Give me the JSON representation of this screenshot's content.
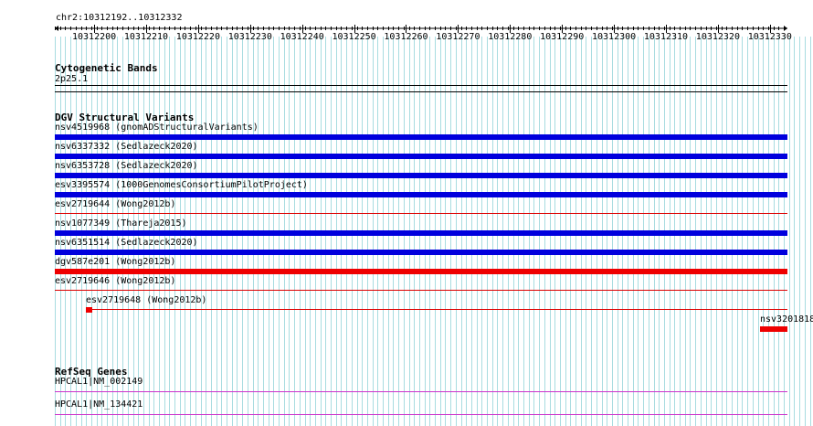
{
  "ruler": {
    "location": "chr2:10312192..10312332",
    "ticks": [
      "10312200",
      "10312210",
      "10312220",
      "10312230",
      "10312240",
      "10312250",
      "10312260",
      "10312270",
      "10312280",
      "10312290",
      "10312300",
      "10312310",
      "10312320",
      "10312330"
    ]
  },
  "cytobands": {
    "title": "Cytogenetic Bands",
    "band": "2p25.1"
  },
  "dgv": {
    "title": "DGV Structural Variants",
    "features": [
      {
        "label": "nsv4519968 (gnomADStructuralVariants)",
        "color": "#0000dd",
        "style": "thick"
      },
      {
        "label": "nsv6337332 (Sedlazeck2020)",
        "color": "#0000dd",
        "style": "thick"
      },
      {
        "label": "nsv6353728 (Sedlazeck2020)",
        "color": "#0000dd",
        "style": "thick"
      },
      {
        "label": "esv3395574 (1000GenomesConsortiumPilotProject)",
        "color": "#0000dd",
        "style": "thick"
      },
      {
        "label": "esv2719644 (Wong2012b)",
        "color": "#dd0000",
        "style": "thin"
      },
      {
        "label": "nsv1077349 (Thareja2015)",
        "color": "#0000dd",
        "style": "thick"
      },
      {
        "label": "nsv6351514 (Sedlazeck2020)",
        "color": "#0000dd",
        "style": "thick"
      },
      {
        "label": "dgv587e201 (Wong2012b)",
        "color": "#ee0000",
        "style": "thick"
      },
      {
        "label": "esv2719646 (Wong2012b)",
        "color": "#dd0000",
        "style": "thin"
      },
      {
        "label": "esv2719648 (Wong2012b)",
        "color": "#dd0000",
        "style": "thin"
      },
      {
        "label": "nsv3201818",
        "color": "#ee0000",
        "style": "thick"
      }
    ]
  },
  "refseq": {
    "title": "RefSeq Genes",
    "genes": [
      {
        "label": "HPCAL1|NM_002149",
        "color": "#cc33cc"
      },
      {
        "label": "HPCAL1|NM_134421",
        "color": "#cc33cc"
      }
    ]
  }
}
